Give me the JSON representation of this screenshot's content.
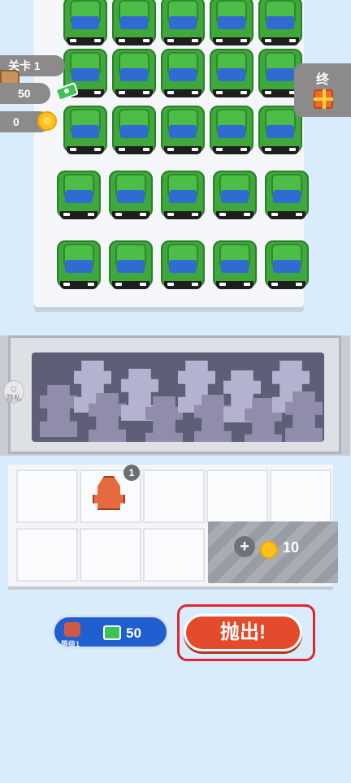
{
  "hud": {
    "level_label": "关卡 1",
    "cash_value": "50",
    "coin_value": "0"
  },
  "final_reward": {
    "label": "终",
    "icon": "gift-icon"
  },
  "crusher": {
    "privacy_label": "隐私"
  },
  "storage": {
    "piece_count": "1",
    "unlock_price": "10",
    "locked_slots": 2
  },
  "bottom": {
    "upgrade_level_label": "等级1",
    "upgrade_price": "50",
    "throw_label": "抛出!"
  },
  "colors": {
    "car_green": "#3ea83a",
    "windshield_blue": "#2f6bd0",
    "throw_red": "#e44a2c",
    "upgrade_blue": "#1f5fcf"
  }
}
